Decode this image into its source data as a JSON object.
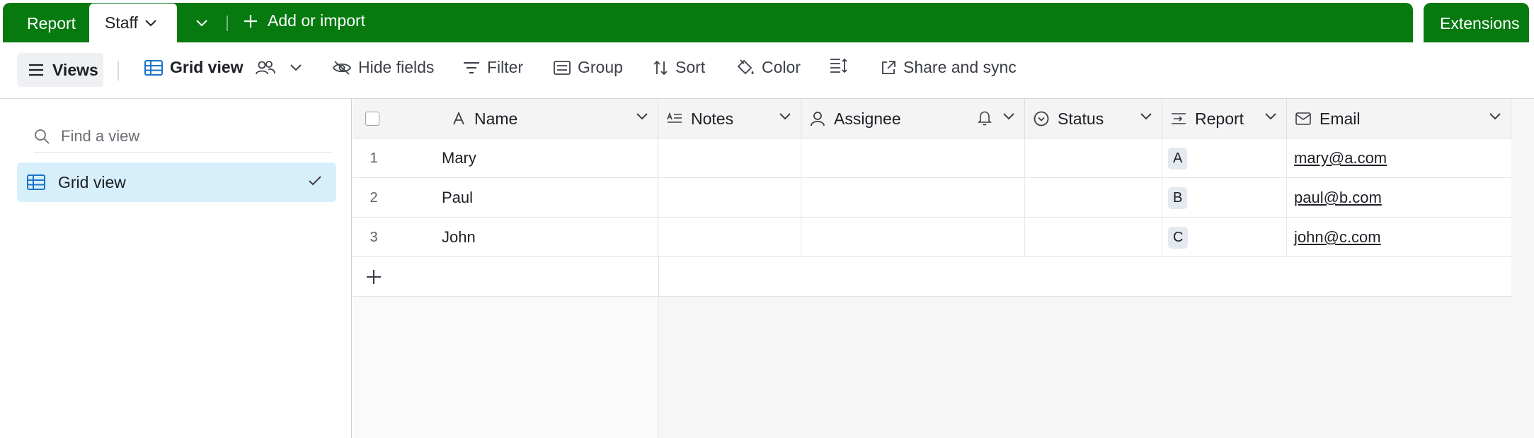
{
  "topbar": {
    "tabs": [
      {
        "label": "Report"
      },
      {
        "label": "Staff"
      }
    ],
    "add_import": "Add or import",
    "extensions": "Extensions"
  },
  "toolbar": {
    "views": "Views",
    "grid_view": "Grid view",
    "hide_fields": "Hide fields",
    "filter": "Filter",
    "group": "Group",
    "sort": "Sort",
    "color": "Color",
    "share_sync": "Share and sync"
  },
  "sidebar": {
    "search_placeholder": "Find a view",
    "views": [
      {
        "label": "Grid view"
      }
    ]
  },
  "table": {
    "columns": [
      {
        "label": "Name"
      },
      {
        "label": "Notes"
      },
      {
        "label": "Assignee"
      },
      {
        "label": "Status"
      },
      {
        "label": "Report"
      },
      {
        "label": "Email"
      }
    ],
    "rows": [
      {
        "num": "1",
        "name": "Mary",
        "report": "A",
        "email": "mary@a.com"
      },
      {
        "num": "2",
        "name": "Paul",
        "report": "B",
        "email": "paul@b.com"
      },
      {
        "num": "3",
        "name": "John",
        "report": "C",
        "email": "john@c.com"
      }
    ]
  },
  "colors": {
    "brand_green": "#067a0f",
    "selected_view_bg": "#d7effb",
    "grid_icon_blue": "#1a73c9"
  }
}
